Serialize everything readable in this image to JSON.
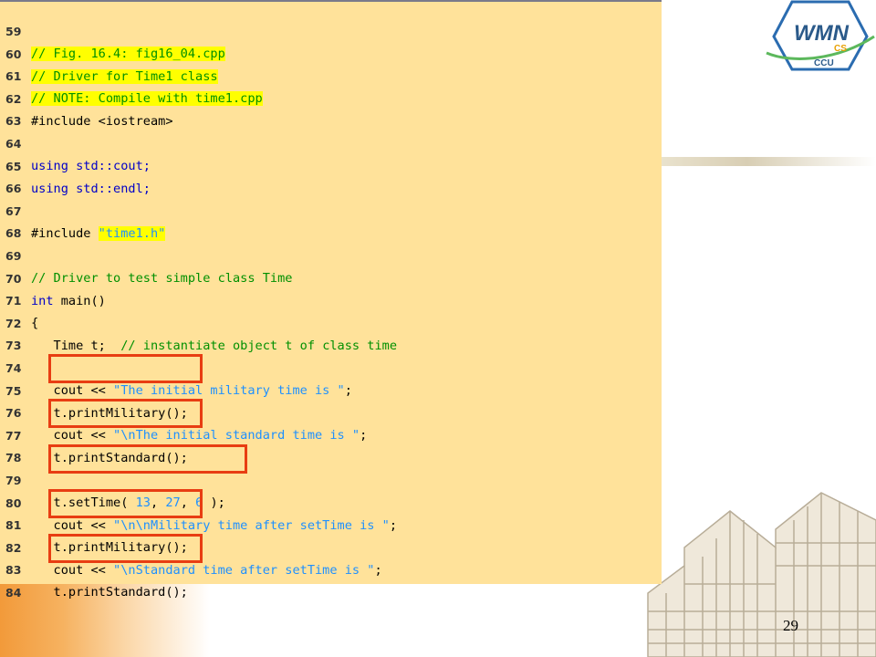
{
  "colors": {
    "panel_bg": "#ffe29a",
    "comment": "#009000",
    "keyword": "#0000c8",
    "string": "#1e90ff",
    "callout": "#e83d12",
    "highlight": "#ffff00"
  },
  "slide_number": "29",
  "logo": {
    "text_main": "WMN",
    "text_sub": "CS",
    "text_org": "CCU"
  },
  "code_lines": [
    {
      "n": "59"
    },
    {
      "n": "60"
    },
    {
      "n": "61"
    },
    {
      "n": "62"
    },
    {
      "n": "63"
    },
    {
      "n": "64"
    },
    {
      "n": "65"
    },
    {
      "n": "66"
    },
    {
      "n": "67"
    },
    {
      "n": "68"
    },
    {
      "n": "69"
    },
    {
      "n": "70"
    },
    {
      "n": "71"
    },
    {
      "n": "72"
    },
    {
      "n": "73"
    },
    {
      "n": "74"
    },
    {
      "n": "75"
    },
    {
      "n": "76"
    },
    {
      "n": "77"
    },
    {
      "n": "78"
    },
    {
      "n": "79"
    },
    {
      "n": "80"
    },
    {
      "n": "81"
    },
    {
      "n": "82"
    },
    {
      "n": "83"
    },
    {
      "n": "84"
    }
  ],
  "code": {
    "l59_a": "// Fig. 16.4: ",
    "l59_b": "fig16_04.cpp",
    "l60": "// Driver for Time1 class",
    "l61": "// NOTE: Compile with time1.cpp",
    "l62": "#include <iostream>",
    "l64": "using std::cout;",
    "l65": "using std::endl;",
    "l67_a": "#include ",
    "l67_b": "\"time1.h\"",
    "l69": "// Driver to test simple class Time",
    "l70_kw": "int",
    "l70_rest": " main()",
    "l71": "{",
    "l72_a": "   Time t;  ",
    "l72_b": "// instantiate object t of class time",
    "l74_a": "   cout << ",
    "l74_b": "\"The initial military time is \"",
    "l74_c": ";",
    "l75": "   t.printMilitary();",
    "l76_a": "   cout << ",
    "l76_b": "\"\\nThe initial standard time is \"",
    "l76_c": ";",
    "l77": "   t.printStandard();",
    "l79_a": "   t.setTime( ",
    "l79_n1": "13",
    "l79_s1": ", ",
    "l79_n2": "27",
    "l79_s2": ", ",
    "l79_n3": "6",
    "l79_e": " );",
    "l80_a": "   cout << ",
    "l80_b": "\"\\n\\nMilitary time after setTime is \"",
    "l80_c": ";",
    "l81": "   t.printMilitary();",
    "l82_a": "   cout << ",
    "l82_b": "\"\\nStandard time after setTime is \"",
    "l82_c": ";",
    "l83": "   t.printStandard();"
  }
}
